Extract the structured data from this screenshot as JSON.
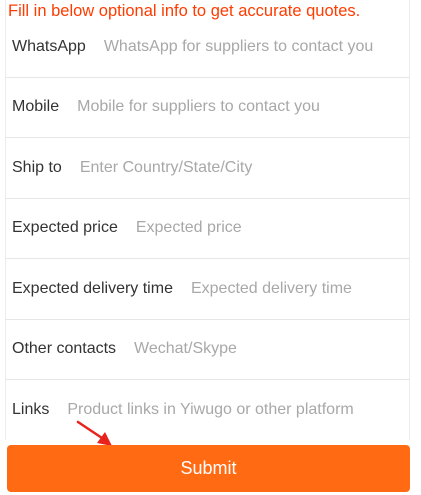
{
  "notice": "Fill in below optional info to get accurate quotes.",
  "fields": [
    {
      "label": "WhatsApp",
      "placeholder": "WhatsApp for suppliers to contact you"
    },
    {
      "label": "Mobile",
      "placeholder": "Mobile for suppliers to contact you"
    },
    {
      "label": "Ship to",
      "placeholder": "Enter Country/State/City"
    },
    {
      "label": "Expected price",
      "placeholder": "Expected price"
    },
    {
      "label": "Expected delivery time",
      "placeholder": "Expected delivery time"
    },
    {
      "label": "Other contacts",
      "placeholder": "Wechat/Skype"
    },
    {
      "label": "Links",
      "placeholder": "Product links in Yiwugo or other platform"
    }
  ],
  "submit_label": "Submit",
  "colors": {
    "accent": "#ff6a13",
    "notice": "#ff3b00",
    "arrow": "#e8221c"
  },
  "icons": {
    "pointer": "red-arrow-icon"
  }
}
